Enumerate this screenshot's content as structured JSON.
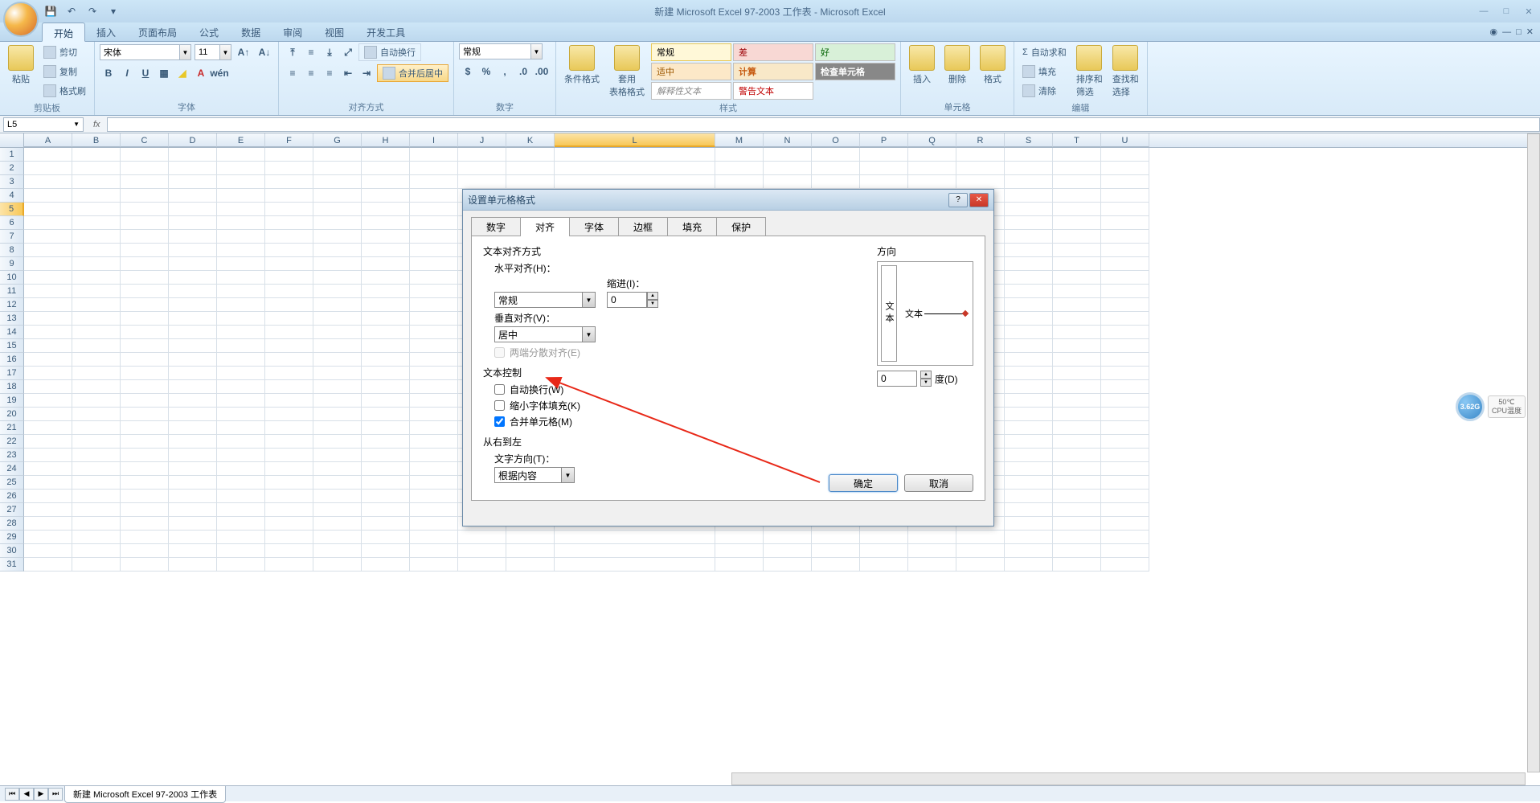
{
  "app": {
    "title": "新建 Microsoft Excel 97-2003 工作表 - Microsoft Excel"
  },
  "ribbon": {
    "tabs": [
      "开始",
      "插入",
      "页面布局",
      "公式",
      "数据",
      "审阅",
      "视图",
      "开发工具"
    ],
    "active_tab": "开始",
    "clipboard": {
      "label": "剪贴板",
      "paste": "粘贴",
      "cut": "剪切",
      "copy": "复制",
      "format": "格式刷"
    },
    "font": {
      "label": "字体",
      "name": "宋体",
      "size": "11"
    },
    "align": {
      "label": "对齐方式",
      "wrap": "自动换行",
      "merge": "合并后居中"
    },
    "number": {
      "label": "数字",
      "format": "常规"
    },
    "cond": {
      "cond_fmt": "条件格式",
      "table_fmt": "套用\n表格格式"
    },
    "styles": {
      "label": "样式",
      "items": [
        {
          "text": "常规",
          "bg": "#fff8d8",
          "fg": "#000",
          "border": "#e8c858"
        },
        {
          "text": "差",
          "bg": "#f8d8d4",
          "fg": "#9c0006"
        },
        {
          "text": "好",
          "bg": "#d8f0d8",
          "fg": "#006100"
        },
        {
          "text": "适中",
          "bg": "#fce8c8",
          "fg": "#9c5700"
        },
        {
          "text": "计算",
          "bg": "#f8e8c8",
          "fg": "#c65a11",
          "bold": true
        },
        {
          "text": "检查单元格",
          "bg": "#888888",
          "fg": "#ffffff",
          "bold": true
        },
        {
          "text": "解释性文本",
          "bg": "#ffffff",
          "fg": "#888888",
          "italic": true
        },
        {
          "text": "警告文本",
          "bg": "#ffffff",
          "fg": "#c00000"
        }
      ]
    },
    "cells": {
      "label": "单元格",
      "insert": "插入",
      "delete": "删除",
      "format": "格式"
    },
    "editing": {
      "label": "编辑",
      "sum": "自动求和",
      "fill": "填充",
      "clear": "清除",
      "sort": "排序和\n筛选",
      "find": "查找和\n选择"
    }
  },
  "formula_bar": {
    "cell_ref": "L5",
    "formula": ""
  },
  "grid": {
    "cols": [
      "A",
      "B",
      "C",
      "D",
      "E",
      "F",
      "G",
      "H",
      "I",
      "J",
      "K",
      "L",
      "M",
      "N",
      "O",
      "P",
      "Q",
      "R",
      "S",
      "T",
      "U"
    ],
    "wide_col": "L",
    "rows": 31,
    "selected_row": 5
  },
  "sheet": {
    "name": "新建 Microsoft Excel 97-2003 工作表"
  },
  "dialog": {
    "title": "设置单元格格式",
    "tabs": [
      "数字",
      "对齐",
      "字体",
      "边框",
      "填充",
      "保护"
    ],
    "active_tab": "对齐",
    "align_section": "文本对齐方式",
    "h_align_label": "水平对齐(H)：",
    "h_align_value": "常规",
    "indent_label": "缩进(I)：",
    "indent_value": "0",
    "v_align_label": "垂直对齐(V)：",
    "v_align_value": "居中",
    "justify_dist": "两端分散对齐(E)",
    "text_control": "文本控制",
    "wrap": "自动换行(W)",
    "shrink": "缩小字体填充(K)",
    "merge": "合并单元格(M)",
    "merge_checked": true,
    "rtl_section": "从右到左",
    "text_dir_label": "文字方向(T)：",
    "text_dir_value": "根据内容",
    "orient_label": "方向",
    "orient_text_v": "文本",
    "orient_text_h": "文本",
    "degree_value": "0",
    "degree_label": "度(D)",
    "ok": "确定",
    "cancel": "取消"
  },
  "gauge": {
    "value": "3.62G",
    "temp": "50℃",
    "label": "CPU温度"
  }
}
